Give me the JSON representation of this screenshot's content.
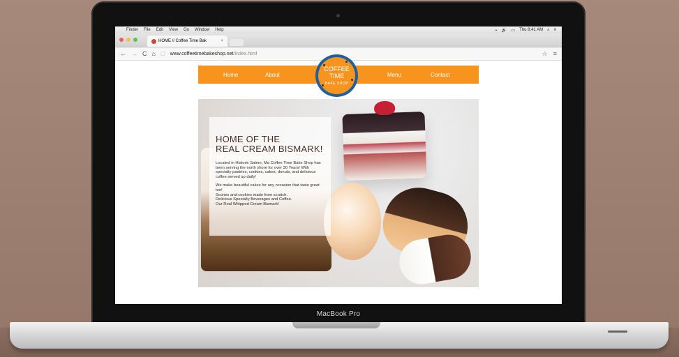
{
  "menubar": {
    "apple": "",
    "items": [
      "Finder",
      "File",
      "Edit",
      "View",
      "Go",
      "Window",
      "Help"
    ],
    "time": "Thu 8:41 AM"
  },
  "browser": {
    "tab_title": "HOME // Coffee Time Bak",
    "url_domain": "www.coffeetimebakeshop.net",
    "url_path": "/index.html"
  },
  "site": {
    "nav": {
      "home": "Home",
      "about": "About",
      "menu": "Menu",
      "contact": "Contact"
    },
    "logo": {
      "line1": "COFFEE",
      "line2": "TIME",
      "line3": "BAKE SHOP"
    },
    "hero": {
      "headline_line1": "HOME OF THE",
      "headline_line2": "REAL CREAM BISMARK!",
      "paragraph1": "Located in Historic Salem, Ma Coffee Time Bake Shop has been serving the north shore for over 30 Years! With specialty pastries, cookies, cakes, donuts, and delicious coffee served up daily!",
      "paragraph2": "We make beautiful cakes for any occasion that taste great too!",
      "line3": "Scones and cookies made from scratch.",
      "line4": "Delicious Specialty Beverages and Coffee.",
      "line5": "Our Real Whipped Cream Bismark!"
    }
  },
  "device": {
    "label": "MacBook Pro"
  },
  "colors": {
    "accent": "#f7941d",
    "logo_ring": "#1e5f9d",
    "text_dark": "#4b3128"
  }
}
